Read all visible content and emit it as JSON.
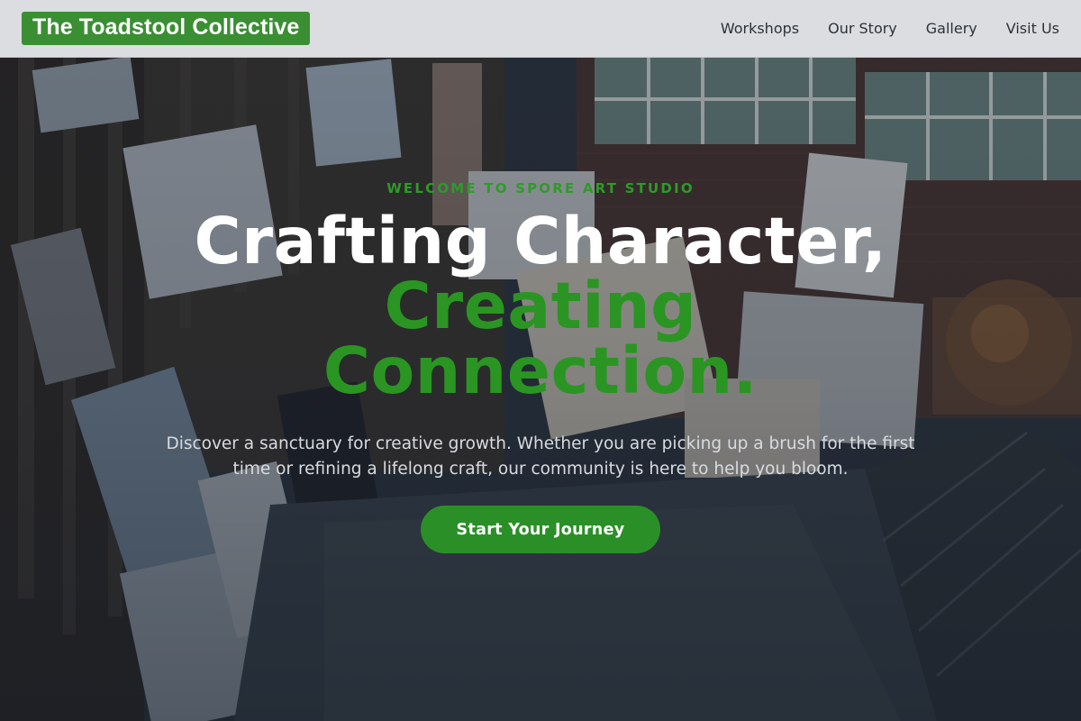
{
  "nav": {
    "brand": "The Toadstool Collective",
    "links": [
      "Workshops",
      "Our Story",
      "Gallery",
      "Visit Us"
    ]
  },
  "hero": {
    "eyebrow": "WELCOME TO SPORE ART STUDIO",
    "headline_line1": "Crafting Character,",
    "headline_line2": "Creating",
    "headline_line3": "Connection.",
    "lead": "Discover a sanctuary for creative growth. Whether you are picking up a brush for the first time or refining a lifelong craft, our community is here to help you bloom.",
    "cta_label": "Start Your Journey",
    "background": "art-studio-photo"
  },
  "colors": {
    "brand_green": "#3a8f33",
    "accent_green": "#2a9522",
    "nav_bg": "#e4e5e7",
    "text_dark": "#2c323a"
  }
}
